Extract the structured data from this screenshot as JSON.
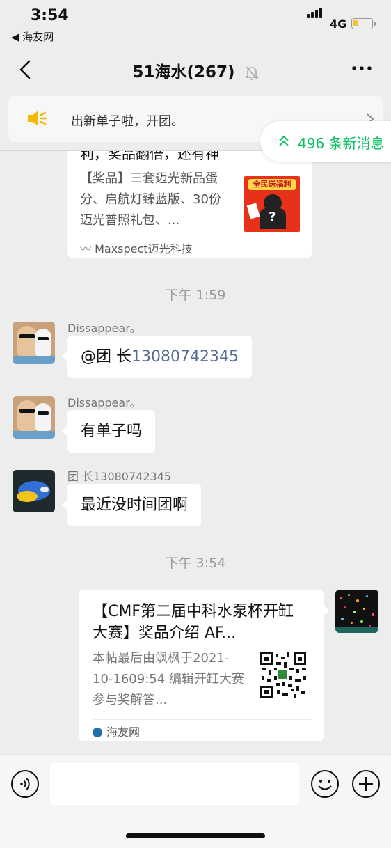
{
  "status": {
    "time": "3:54",
    "back_app": "◀ 海友网",
    "network": "4G",
    "battery_level": 0.2
  },
  "nav": {
    "title": "51海水(267)",
    "muted": true
  },
  "notice": {
    "text": "出新单子啦，开团。"
  },
  "new_messages": {
    "label": "496 条新消息"
  },
  "link_card_1": {
    "title": "利，奖品翻倍，还有神",
    "description": "【奖品】三套迈光新品蛋分、启航灯臻蓝版、30份迈光普照礼包、...",
    "thumb_text": "全民送福利",
    "source": "Maxspect迈光科技"
  },
  "messages": [
    {
      "type": "time",
      "text": "下午 1:59"
    },
    {
      "type": "text",
      "sender": "Dissappear。",
      "mention": "@团 长",
      "mention_number": "13080742345"
    },
    {
      "type": "text",
      "sender": "Dissappear。",
      "text": "有单子吗"
    },
    {
      "type": "text",
      "sender": "团 长13080742345",
      "text": "最近没时间团啊"
    },
    {
      "type": "time",
      "text": "下午 3:54"
    }
  ],
  "link_card_2": {
    "title": "【CMF第二届中科水泵杯开缸大赛】奖品介绍 AF...",
    "description": "本帖最后由飒枫于2021-10-1609:54 编辑开缸大赛参与奖解答...",
    "source": "海友网"
  },
  "input": {
    "value": "",
    "placeholder": ""
  },
  "colors": {
    "accent_green": "#07c160",
    "mention_blue": "#576b95",
    "background": "#ededed"
  },
  "icons": {
    "nav_back": "chevron-left-icon",
    "mute": "bell-off-icon",
    "more": "ellipsis-icon",
    "notice": "megaphone-icon",
    "new_messages": "double-chevron-up-icon",
    "voice": "voice-icon",
    "emoji": "smiley-icon",
    "plus": "plus-circle-icon"
  }
}
